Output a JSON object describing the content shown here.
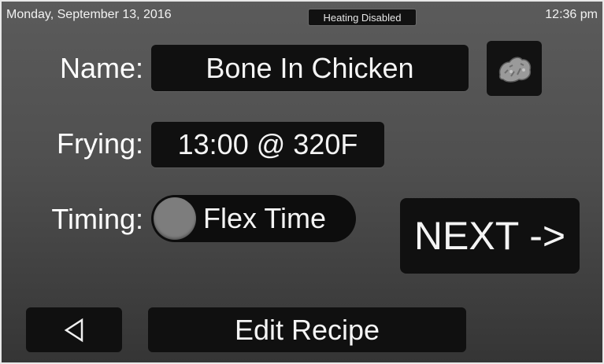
{
  "status_bar": {
    "date": "Monday, September 13, 2016",
    "heating_status": "Heating Disabled",
    "time": "12:36 pm"
  },
  "recipe": {
    "name_label": "Name:",
    "name_value": "Bone In Chicken",
    "icon": "fried-chicken-icon",
    "frying_label": "Frying:",
    "frying_value": "13:00 @ 320F",
    "timing_label": "Timing:",
    "timing_value": "Flex Time",
    "timing_toggle_on": false
  },
  "buttons": {
    "next_label": "NEXT ->",
    "back_icon": "back-triangle-icon",
    "edit_label": "Edit Recipe"
  },
  "colors": {
    "background_top": "#5b5b5b",
    "background_bottom": "#353535",
    "button_bg": "#101010",
    "text": "#ffffff"
  }
}
